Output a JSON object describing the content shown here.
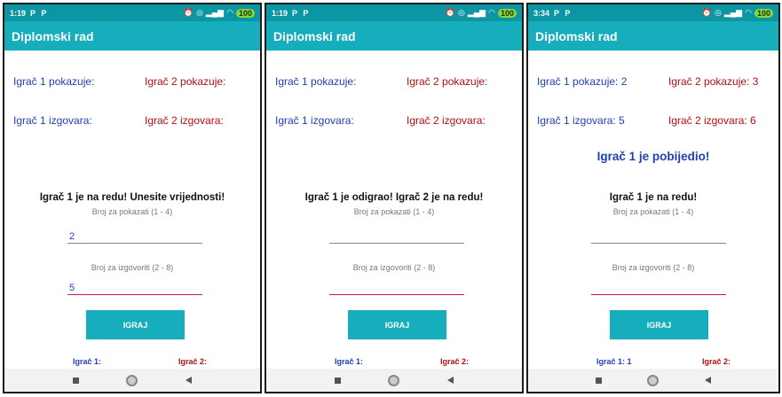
{
  "screens": [
    {
      "status": {
        "time": "1:19",
        "battery": "100"
      },
      "app_title": "Diplomski rad",
      "p1_shows": "Igrač 1 pokazuje:",
      "p2_shows": "Igrač 2 pokazuje:",
      "p1_says": "Igrač 1 izgovara:",
      "p2_says": "Igrač 2 izgovara:",
      "winner": "",
      "turn_message": "Igrač 1 je na redu! Unesite vrijednosti!",
      "show_hint": "Broj za pokazati (1 - 4)",
      "show_value": "2",
      "say_hint": "Broj za izgovoriti (2 - 8)",
      "say_value": "5",
      "play_label": "IGRAJ",
      "p1_score": "Igrač 1:",
      "p2_score": "Igrač 2:"
    },
    {
      "status": {
        "time": "1:19",
        "battery": "100"
      },
      "app_title": "Diplomski rad",
      "p1_shows": "Igrač 1 pokazuje:",
      "p2_shows": "Igrač 2 pokazuje:",
      "p1_says": "Igrač 1 izgovara:",
      "p2_says": "Igrač 2 izgovara:",
      "winner": "",
      "turn_message": "Igrač 1 je odigrao! Igrač 2 je na redu!",
      "show_hint": "Broj za pokazati (1 - 4)",
      "show_value": "",
      "say_hint": "Broj za izgovoriti (2 - 8)",
      "say_value": "",
      "play_label": "IGRAJ",
      "p1_score": "Igrač 1:",
      "p2_score": "Igrač 2:"
    },
    {
      "status": {
        "time": "3:34",
        "battery": "100"
      },
      "app_title": "Diplomski rad",
      "p1_shows": "Igrač 1 pokazuje: 2",
      "p2_shows": "Igrač 2 pokazuje: 3",
      "p1_says": "Igrač 1 izgovara: 5",
      "p2_says": "Igrač 2 izgovara: 6",
      "winner": "Igrač 1 je pobijedio!",
      "turn_message": "Igrač 1 je na redu!",
      "show_hint": "Broj za pokazati (1 - 4)",
      "show_value": "",
      "say_hint": "Broj za izgovoriti (2 - 8)",
      "say_value": "",
      "play_label": "IGRAJ",
      "p1_score": "Igrač 1: 1",
      "p2_score": "Igrač 2:"
    }
  ],
  "colors": {
    "status_bar": "#0c96a3",
    "app_bar": "#16adbd",
    "player1": "#1f3fb0",
    "player2": "#b01010",
    "accent_underline": "#c2185b"
  },
  "icons": {
    "status": [
      "notification-p-icon",
      "notification-p-icon",
      "alarm-icon",
      "vibrate-icon",
      "signal-icon",
      "wifi-icon",
      "battery-icon"
    ],
    "nav": [
      "recents-square-icon",
      "home-circle-icon",
      "back-triangle-icon"
    ]
  }
}
